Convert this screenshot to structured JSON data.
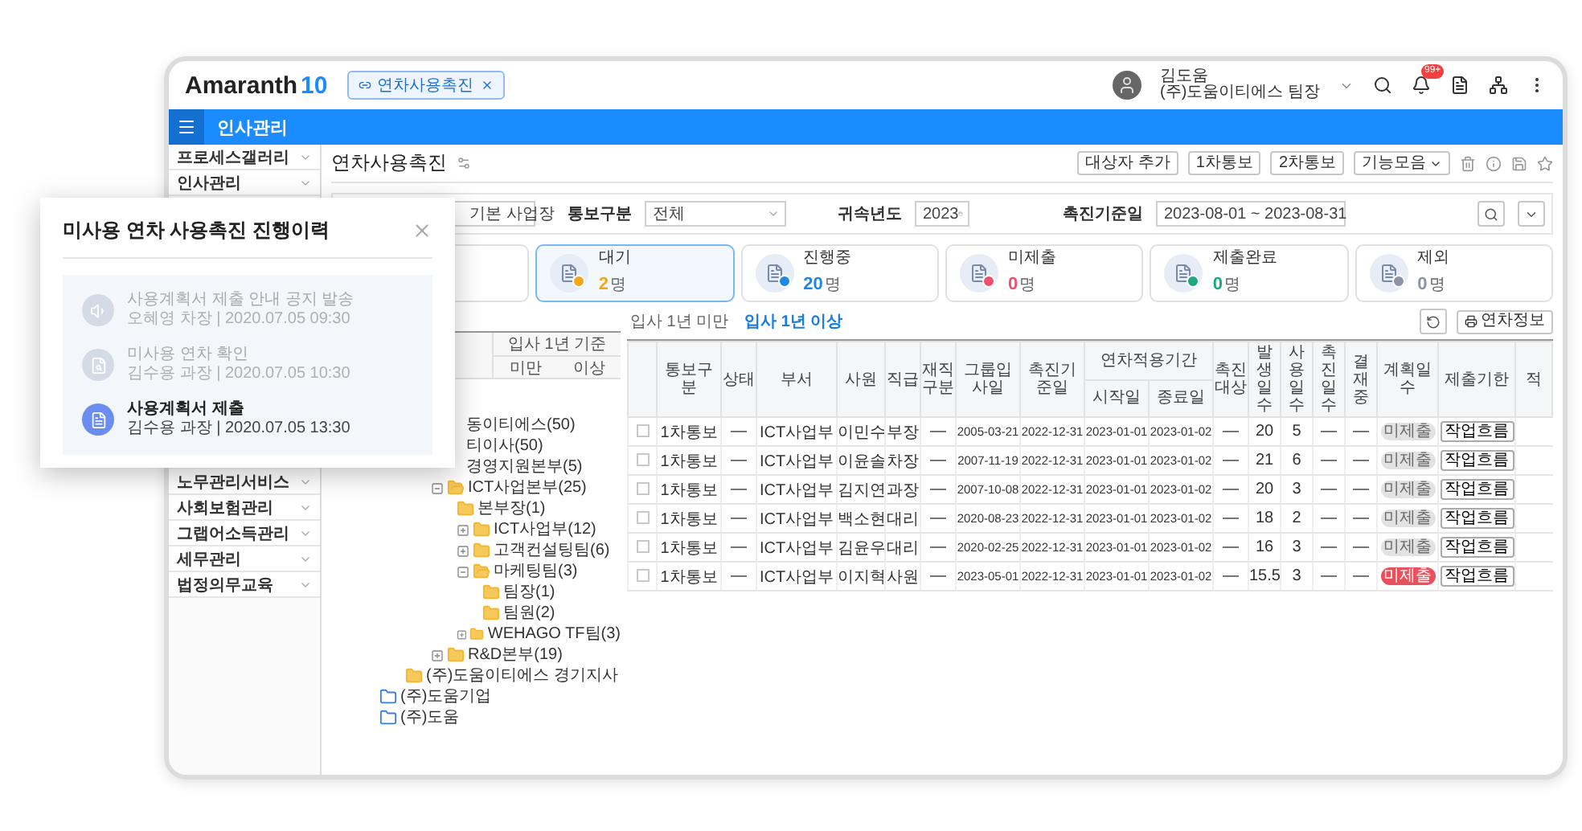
{
  "header": {
    "logo": "Amaranth",
    "logo_accent": "10",
    "tab": {
      "label": "연차사용촉진"
    },
    "user": {
      "name": "김도움",
      "org": "(주)도움이티에스 팀장"
    },
    "notification_badge": "99+"
  },
  "menu_bar": {
    "title": "인사관리"
  },
  "sidebar": {
    "top_items": [
      {
        "label": "프로세스갤러리"
      },
      {
        "label": "인사관리"
      }
    ],
    "bottom_items": [
      {
        "label": "노무관리서비스"
      },
      {
        "label": "사회보험관리"
      },
      {
        "label": "그랩어소득관리"
      },
      {
        "label": "세무관리"
      },
      {
        "label": "법정의무교육"
      }
    ]
  },
  "page": {
    "title": "연차사용촉진",
    "buttons": [
      "대상자 추가",
      "1차통보",
      "2차통보"
    ],
    "menu_button": "기능모음"
  },
  "filters": {
    "site": "기본 사업장",
    "notice_type_label": "통보구분",
    "notice_type": "전체",
    "year_label": "귀속년도",
    "year": "2023",
    "date_label": "촉진기준일",
    "date_range": "2023-08-01 ~ 2023-08-31"
  },
  "status_cards": [
    {
      "label": "대기",
      "count": "2",
      "unit": "명",
      "selected": true,
      "color": "#f0a818"
    },
    {
      "label": "진행중",
      "count": "20",
      "unit": "명",
      "selected": false,
      "color": "#1e88e5"
    },
    {
      "label": "미제출",
      "count": "0",
      "unit": "명",
      "selected": false,
      "color": "#f0506e"
    },
    {
      "label": "제출완료",
      "count": "0",
      "unit": "명",
      "selected": false,
      "color": "#1aaa80"
    },
    {
      "label": "제외",
      "count": "0",
      "unit": "명",
      "selected": false,
      "color": "#8a94a6"
    }
  ],
  "side_table": {
    "group_header": "입사 1년 기준",
    "columns": [
      "미만",
      "이상"
    ]
  },
  "org_tree": [
    {
      "label": "동이티에스(50)",
      "kind": "folder",
      "cut": true,
      "children": [
        {
          "label": "티이사(50)",
          "kind": "folder",
          "cut": true,
          "children": [
            {
              "label": "경영지원본부(5)",
              "kind": "folder",
              "cut": true
            },
            {
              "label": "ICT사업본부(25)",
              "kind": "folder",
              "expanded": true,
              "children": [
                {
                  "label": "본부장(1)",
                  "kind": "folder"
                },
                {
                  "label": "ICT사업부(12)",
                  "kind": "folder",
                  "expanded": false
                },
                {
                  "label": "고객컨설팅팀(6)",
                  "kind": "folder",
                  "expanded": false
                },
                {
                  "label": "마케팅팀(3)",
                  "kind": "folder",
                  "expanded": true,
                  "children": [
                    {
                      "label": "팀장(1)",
                      "kind": "folder"
                    },
                    {
                      "label": "팀원(2)",
                      "kind": "folder"
                    }
                  ]
                },
                {
                  "label": "WEHAGO TF팀(3)",
                  "kind": "folder",
                  "expanded": false
                }
              ]
            },
            {
              "label": "R&D본부(19)",
              "kind": "folder",
              "expanded": false
            }
          ]
        },
        {
          "label": "(주)도움이티에스 경기지사",
          "kind": "folder"
        }
      ]
    },
    {
      "label": "(주)도움기업",
      "kind": "company"
    },
    {
      "label": "(주)도움",
      "kind": "company"
    }
  ],
  "list_tabs": [
    {
      "label": "입사 1년 미만",
      "selected": false
    },
    {
      "label": "입사 1년 이상",
      "selected": true
    }
  ],
  "info_button": "연차정보",
  "table": {
    "columns": [
      {
        "label": "통보구분"
      },
      {
        "label": "상태"
      },
      {
        "label": "부서"
      },
      {
        "label": "사원"
      },
      {
        "label": "직급"
      },
      {
        "label": "재직구분"
      },
      {
        "label": "그룹입사일"
      },
      {
        "label": "촉진기준일"
      },
      {
        "label": "연차적용기간",
        "colspan": 2,
        "children": [
          {
            "label": "시작일"
          },
          {
            "label": "종료일"
          }
        ]
      },
      {
        "label": "촉진대상"
      },
      {
        "label": "발생일수"
      },
      {
        "label": "사용일수"
      },
      {
        "label": "촉진일수"
      },
      {
        "label": "결재중"
      },
      {
        "label": "계획일수"
      },
      {
        "label": "제출기한"
      },
      {
        "label": "적"
      }
    ],
    "rows": [
      {
        "checked": false,
        "cells": [
          "1차통보",
          "—",
          "ICT사업부",
          "이민수",
          "부장",
          "—",
          "2005-03-21",
          "2022-12-31",
          "2023-01-01",
          "2023-01-02",
          "—",
          "20",
          "5",
          "—",
          "—"
        ],
        "plan": {
          "label": "미제출",
          "disabled": true
        },
        "action": "작업흐름"
      },
      {
        "checked": false,
        "cells": [
          "1차통보",
          "—",
          "ICT사업부",
          "이윤솔",
          "차장",
          "—",
          "2007-11-19",
          "2022-12-31",
          "2023-01-01",
          "2023-01-02",
          "—",
          "21",
          "6",
          "—",
          "—"
        ],
        "plan": {
          "label": "미제출",
          "disabled": true
        },
        "action": "작업흐름"
      },
      {
        "checked": false,
        "cells": [
          "1차통보",
          "—",
          "ICT사업부",
          "김지연",
          "과장",
          "—",
          "2007-10-08",
          "2022-12-31",
          "2023-01-01",
          "2023-01-02",
          "—",
          "20",
          "3",
          "—",
          "—"
        ],
        "plan": {
          "label": "미제출",
          "disabled": true
        },
        "action": "작업흐름"
      },
      {
        "checked": false,
        "cells": [
          "1차통보",
          "—",
          "ICT사업부",
          "백소현",
          "대리",
          "—",
          "2020-08-23",
          "2022-12-31",
          "2023-01-01",
          "2023-01-02",
          "—",
          "18",
          "2",
          "—",
          "—"
        ],
        "plan": {
          "label": "미제출",
          "disabled": true
        },
        "action": "작업흐름"
      },
      {
        "checked": false,
        "cells": [
          "1차통보",
          "—",
          "ICT사업부",
          "김윤우",
          "대리",
          "—",
          "2020-02-25",
          "2022-12-31",
          "2023-01-01",
          "2023-01-02",
          "—",
          "16",
          "3",
          "—",
          "—"
        ],
        "plan": {
          "label": "미제출",
          "disabled": true
        },
        "action": "작업흐름"
      },
      {
        "checked": false,
        "cells": [
          "1차통보",
          "—",
          "ICT사업부",
          "이지혁",
          "사원",
          "—",
          "2023-05-01",
          "2022-12-31",
          "2023-01-01",
          "2023-01-02",
          "—",
          "15.5",
          "3",
          "—",
          "—"
        ],
        "plan": {
          "label": "미제출",
          "disabled": false
        },
        "action": "작업흐름"
      }
    ]
  },
  "history_popup": {
    "title": "미사용 연차 사용촉진 진행이력",
    "separator": "|",
    "steps": [
      {
        "kind": "notice",
        "title": "사용계획서 제출 안내 공지 발송",
        "person": "오혜영 차장",
        "time": "2020.07.05 09:30",
        "current": false
      },
      {
        "kind": "check",
        "title": "미사용 연차 확인",
        "person": "김수용 과장",
        "time": "2020.07.05 10:30",
        "current": false
      },
      {
        "kind": "submit",
        "title": "사용계획서 제출",
        "person": "김수용 과장",
        "time": "2020.07.05 13:30",
        "current": true
      }
    ]
  }
}
